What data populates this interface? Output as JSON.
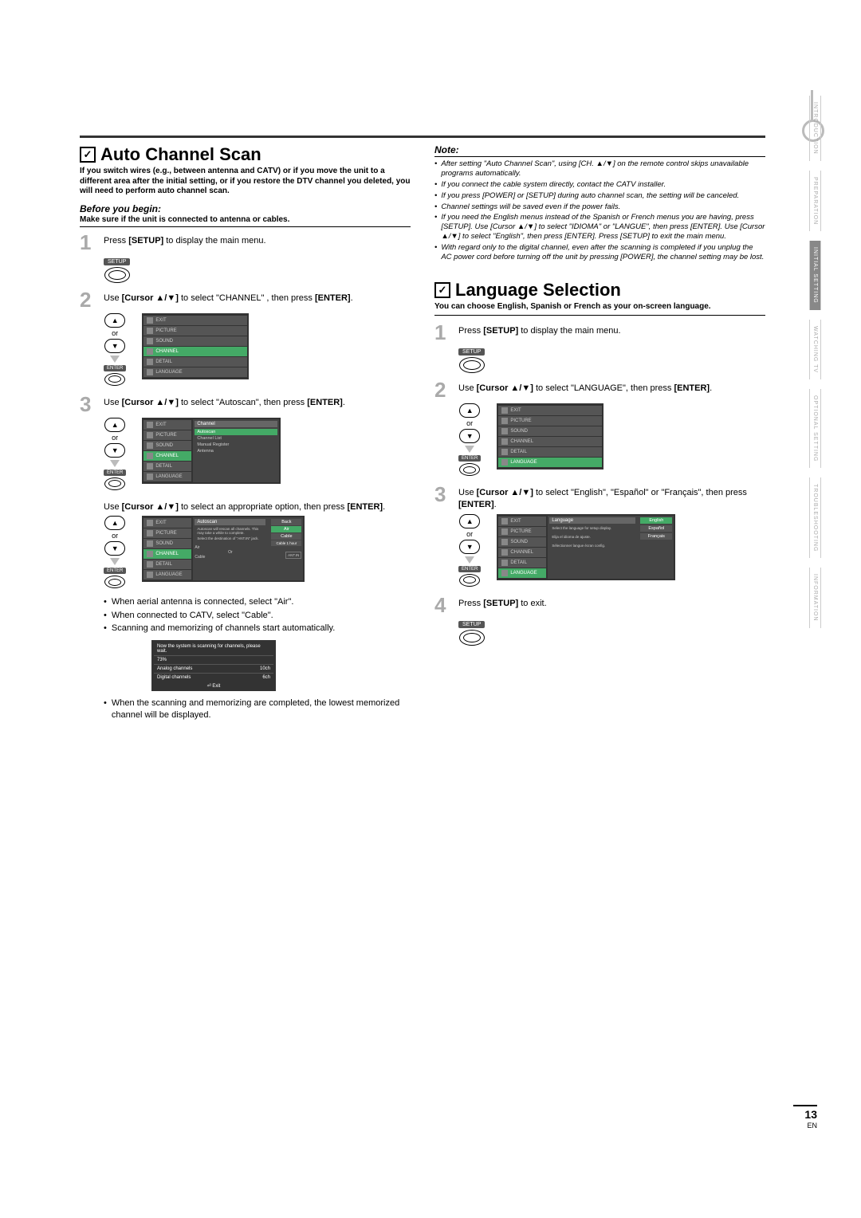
{
  "page_number": "13",
  "page_lang": "EN",
  "side_tabs": [
    "INTRODUCTION",
    "PREPARATION",
    "INITIAL SETTING",
    "WATCHING TV",
    "OPTIONAL SETTING",
    "TROUBLESHOOTING",
    "INFORMATION"
  ],
  "side_tab_active": 2,
  "section_a": {
    "title": "Auto Channel Scan",
    "intro": "If you switch wires (e.g., between antenna and CATV) or if you move the unit to a different area after the initial setting, or if you restore the DTV channel you deleted, you will need to perform auto channel scan.",
    "before_h": "Before you begin:",
    "before_body": "Make sure if the unit is connected to antenna or cables.",
    "step1_pre": "Press ",
    "step1_btn": "[SETUP]",
    "step1_post": " to display the main menu.",
    "setup_label": "SETUP",
    "step2_p1": "Use ",
    "step2_b1": "[Cursor ▲/▼]",
    "step2_p2": " to select \"CHANNEL\" , then press ",
    "step2_b2": "[ENTER]",
    "step2_p3": ".",
    "or": "or",
    "enter_label": "ENTER",
    "menu_items": [
      "EXIT",
      "PICTURE",
      "SOUND",
      "CHANNEL",
      "DETAIL",
      "LANGUAGE"
    ],
    "step3_p1": "Use ",
    "step3_b1": "[Cursor ▲/▼]",
    "step3_p2": " to select \"Autoscan\", then press ",
    "step3_b2": "[ENTER]",
    "step3_p3": ".",
    "channel_sub": [
      "Autoscan",
      "Channel List",
      "Manual Register",
      "Antenna"
    ],
    "channel_title": "Channel",
    "step3b_p1": "Use ",
    "step3b_b1": "[Cursor ▲/▼]",
    "step3b_p2": " to select an appropriate option, then press ",
    "step3b_b2": "[ENTER]",
    "step3b_p3": ".",
    "autoscan_title": "Autoscan",
    "autoscan_msg1": "Autoscan will rescan all channels. This may take a while to complete.",
    "autoscan_msg2": "Select the destination of \"ANT.IN\" jack.",
    "autoscan_opts": [
      "Back",
      "Air",
      "Cable",
      "Cable 1 hour"
    ],
    "air_label": "Air",
    "cable_label": "Cable",
    "or_label": "Or",
    "antin_label": "ANT.IN",
    "bullets1": [
      "When aerial antenna is connected, select \"Air\".",
      "When connected to CATV, select \"Cable\".",
      "Scanning and memorizing of channels start automatically."
    ],
    "scan_msg": "Now the system is scanning for channels, please wait.",
    "scan_pct": "73%",
    "scan_r1_l": "Analog channels",
    "scan_r1_v": "10ch",
    "scan_r2_l": "Digital channels",
    "scan_r2_v": "6ch",
    "scan_exit": "Exit",
    "bullets2": [
      "When the scanning and memorizing are completed, the lowest memorized channel will be displayed."
    ]
  },
  "note": {
    "h": "Note:",
    "items": [
      "After setting \"Auto Channel Scan\", using [CH. ▲/▼] on the remote control skips unavailable programs automatically.",
      "If you connect the cable system directly, contact the CATV installer.",
      "If you press [POWER] or [SETUP] during auto channel scan, the setting will be canceled.",
      "Channel settings will be saved even if the power fails.",
      "If you need the English menus instead of the Spanish or French menus you are having, press [SETUP]. Use [Cursor ▲/▼] to select \"IDIOMA\" or \"LANGUE\", then press [ENTER]. Use [Cursor ▲/▼] to select \"English\", then press [ENTER]. Press [SETUP] to exit the main menu.",
      "With regard only to the digital channel, even after the scanning is completed if you unplug the AC power cord before turning off the unit by pressing [POWER], the channel setting may be lost."
    ]
  },
  "section_b": {
    "title": "Language Selection",
    "intro": "You can choose English, Spanish or French as your on-screen language.",
    "step1_pre": "Press ",
    "step1_btn": "[SETUP]",
    "step1_post": " to display the main menu.",
    "step2_p1": "Use ",
    "step2_b1": "[Cursor ▲/▼]",
    "step2_p2": " to select \"LANGUAGE\", then press ",
    "step2_b2": "[ENTER]",
    "step2_p3": ".",
    "step3_p1": "Use ",
    "step3_b1": "[Cursor ▲/▼]",
    "step3_p2": " to select \"English\", \"Español\" or \"Français\", then press ",
    "step3_b2": "[ENTER]",
    "step3_p3": ".",
    "lang_title": "Language",
    "lang_row1": "Select the language for setup display.",
    "lang_row2": "Elija el idioma de ajuste.",
    "lang_row3": "Sélectionner langue écran config.",
    "lang_opts": [
      "English",
      "Español",
      "Français"
    ],
    "step4_pre": "Press ",
    "step4_btn": "[SETUP]",
    "step4_post": " to exit."
  }
}
